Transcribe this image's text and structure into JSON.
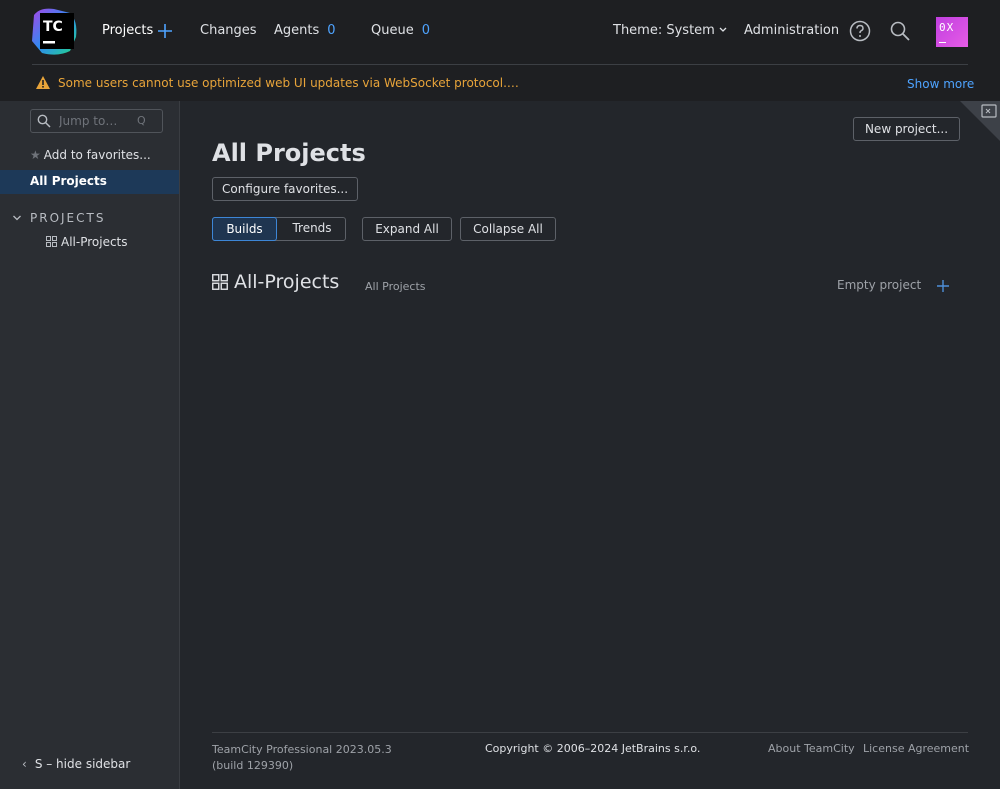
{
  "header": {
    "logo_text": "TC",
    "nav": {
      "projects": "Projects",
      "changes": "Changes",
      "agents": "Agents",
      "agents_count": "0",
      "queue": "Queue",
      "queue_count": "0"
    },
    "theme": "Theme: System",
    "administration": "Administration",
    "avatar_text": "0X",
    "warning": "Some users cannot use optimized web UI updates via WebSocket protocol.…",
    "show_more": "Show more"
  },
  "sidebar": {
    "jump_placeholder": "Jump to…",
    "jump_shortcut": "Q",
    "add_favorites": "Add to favorites...",
    "all_projects": "All Projects",
    "projects_heading": "PROJECTS",
    "tree_item": "All-Projects",
    "hide_sidebar": "S – hide sidebar"
  },
  "main": {
    "new_project": "New project...",
    "title": "All Projects",
    "configure_favorites": "Configure favorites...",
    "tabs": [
      "Builds",
      "Trends"
    ],
    "expand_all": "Expand All",
    "collapse_all": "Collapse All",
    "project": {
      "name": "All-Projects",
      "crumb": "All Projects",
      "status": "Empty project"
    }
  },
  "footer": {
    "version_line1": "TeamCity Professional 2023.05.3",
    "version_line2": "(build 129390)",
    "copyright": "Copyright © 2006–2024 JetBrains s.r.o.",
    "about": "About TeamCity",
    "license": "License Agreement"
  },
  "colors": {
    "accent": "#4ea3ff",
    "warning": "#e8a43a",
    "selected_nav": "#1d3958",
    "avatar": "#d14fe6"
  }
}
